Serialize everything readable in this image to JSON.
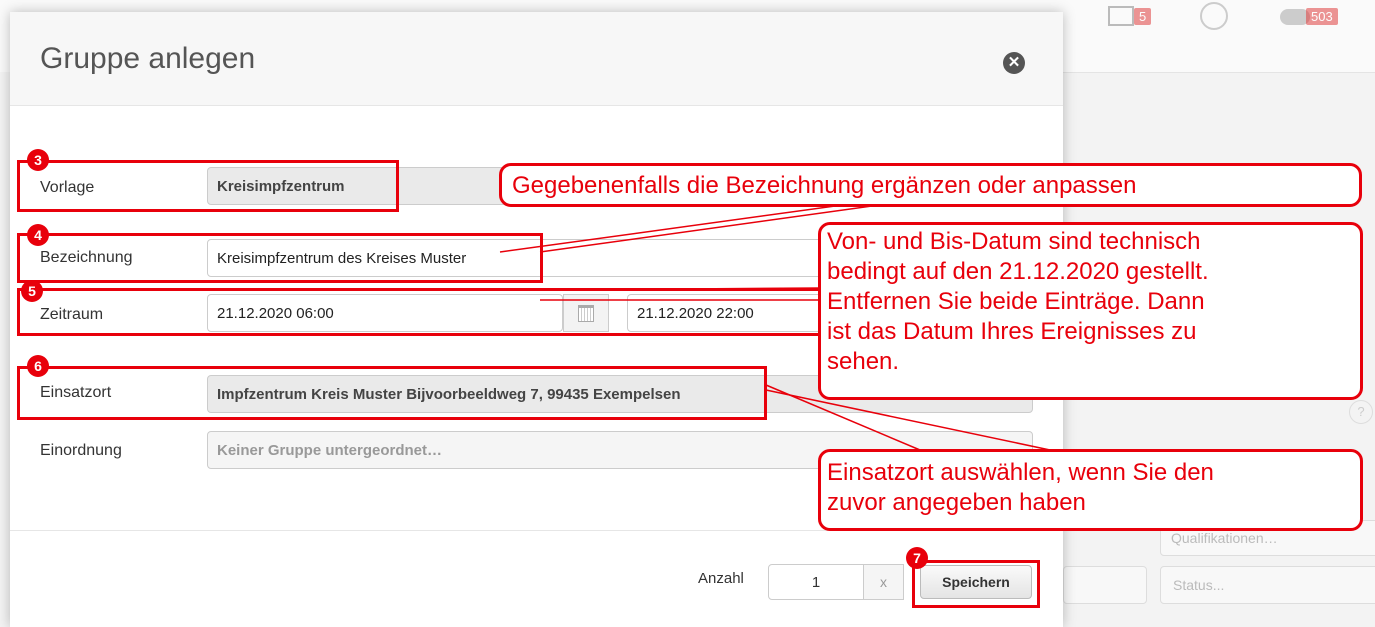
{
  "background": {
    "badge_mail": "5",
    "badge_cloud": "503",
    "placeholder_status": "Status...",
    "placeholder_qualifikation": "Qualifikationen…"
  },
  "modal": {
    "title": "Gruppe anlegen",
    "fields": {
      "vorlage": {
        "label": "Vorlage",
        "value": "Kreisimpfzentrum"
      },
      "bezeichnung": {
        "label": "Bezeichnung",
        "value": "Kreisimpfzentrum des Kreises Muster"
      },
      "zeitraum": {
        "label": "Zeitraum",
        "from": "21.12.2020 06:00",
        "to": "21.12.2020 22:00"
      },
      "einsatzort": {
        "label": "Einsatzort",
        "value": "Impfzentrum Kreis Muster Bijvoorbeeldweg 7, 99435 Exempelsen"
      },
      "einordnung": {
        "label": "Einordnung",
        "placeholder": "Keiner Gruppe untergeordnet…"
      }
    },
    "footer": {
      "anzahl_label": "Anzahl",
      "anzahl_value": "1",
      "anzahl_suffix": "x",
      "save_label": "Speichern"
    }
  },
  "annotations": {
    "markers": [
      "3",
      "4",
      "5",
      "6",
      "7"
    ],
    "callout_bezeichnung": "Gegebenenfalls die Bezeichnung ergänzen oder anpassen",
    "callout_datum_lines": [
      "Von- und Bis-Datum sind technisch",
      "bedingt auf den 21.12.2020 gestellt.",
      "Entfernen Sie beide Einträge. Dann",
      "ist das Datum Ihres Ereignisses zu",
      "sehen."
    ],
    "callout_einsatzort_lines": [
      "Einsatzort auswählen, wenn Sie den",
      "zuvor angegeben haben"
    ],
    "color": "#e8000b"
  }
}
